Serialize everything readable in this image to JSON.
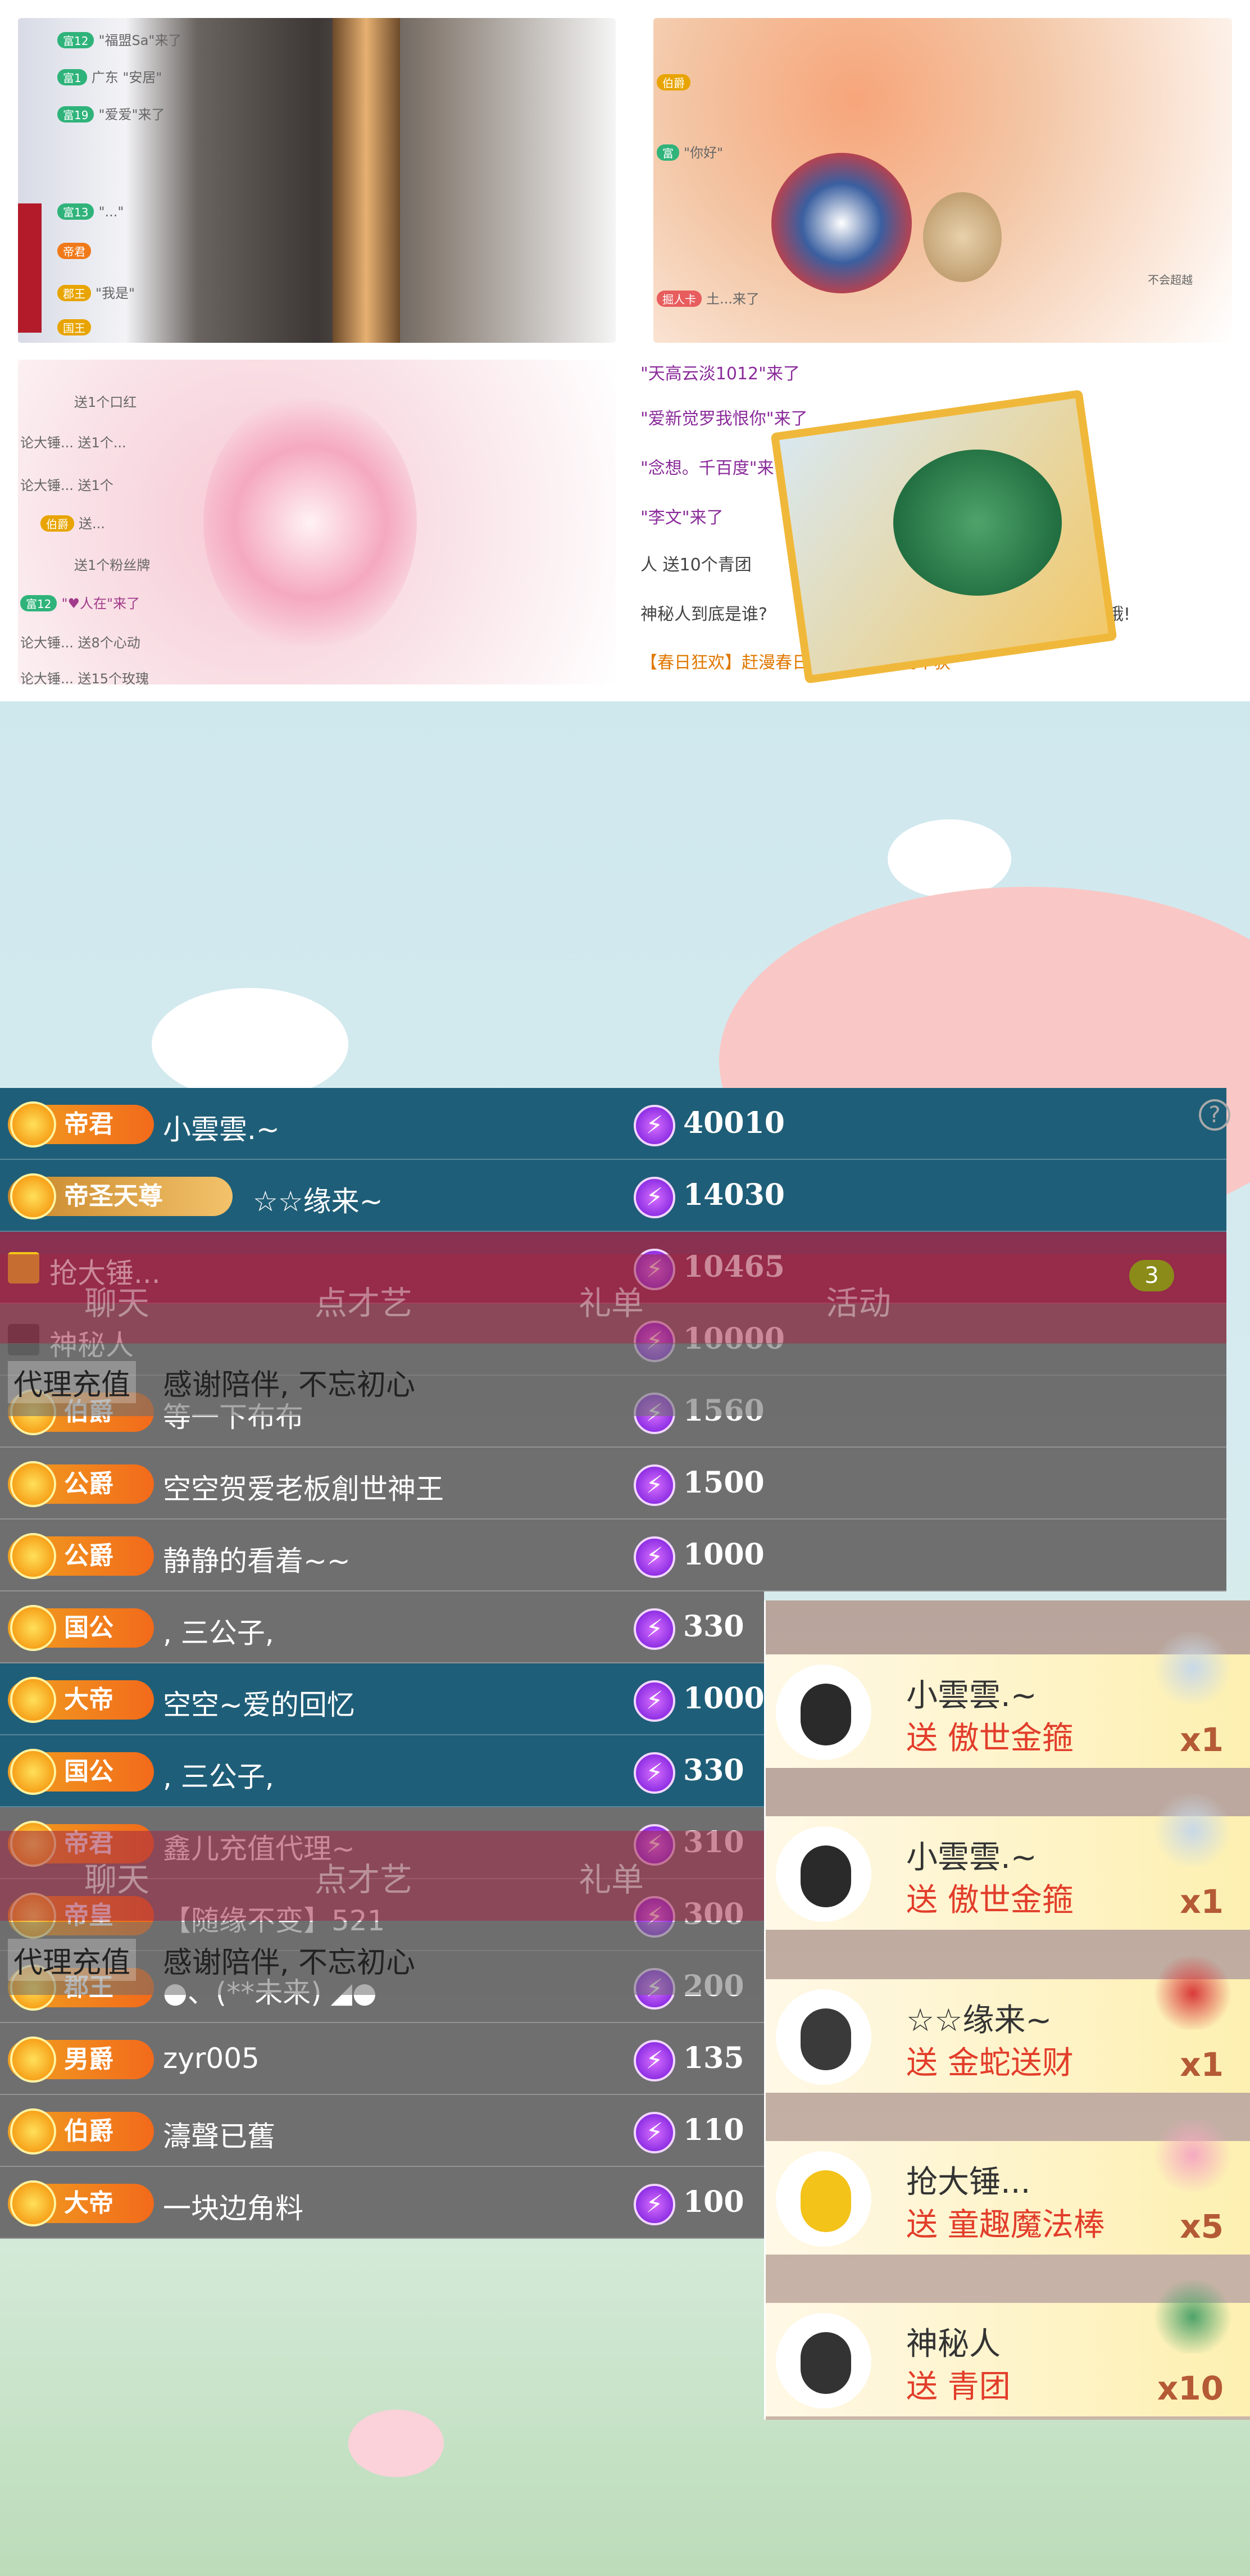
{
  "shots": {
    "s1": {
      "lines": [
        {
          "tag": "富12",
          "text": "\"福盟Sa\"来了"
        },
        {
          "tag": "富1",
          "text": "广东 \"安居\""
        },
        {
          "tag": "富19",
          "text": "\"爱爱\"来了"
        },
        {
          "tag": "富13",
          "text": "\"...\""
        },
        {
          "tag": "帝君",
          "text": ""
        },
        {
          "tag": "郡王",
          "text": "\"我是\""
        },
        {
          "tag": "国王",
          "text": ""
        }
      ]
    },
    "s2": {
      "lines": [
        {
          "tag": "伯爵",
          "text": ""
        },
        {
          "tag": "富",
          "text": "\"你好\""
        },
        {
          "tag": "掘人卡",
          "text": "土...来了"
        }
      ],
      "corner": "不会超越"
    },
    "s3": {
      "lines": [
        {
          "tag": "",
          "text": "送1个口红"
        },
        {
          "tag": "",
          "text": "论大锤... 送1个..."
        },
        {
          "tag": "",
          "text": "论大锤... 送1个"
        },
        {
          "tag": "伯爵",
          "text": "送..."
        },
        {
          "tag": "",
          "text": "送1个粉丝牌"
        },
        {
          "tag": "富12",
          "text": "\"♥人在\"来了"
        },
        {
          "tag": "",
          "text": "论大锤... 送8个心动"
        },
        {
          "tag": "",
          "text": "论大锤... 送15个玫瑰"
        }
      ]
    },
    "s4": {
      "lines": [
        "\"天高云淡1012\"来了",
        "\"爱新觉罗我恨你\"来了",
        "\"念想。千百度\"来了",
        "\"李文\"来了",
        "人 送10个青团",
        "神秘人到底是谁?",
        "【春日狂欢】赶漫春日, 日漫游\" 活动中获"
      ],
      "trailing": "哦!"
    }
  },
  "ranking": [
    {
      "badge": "帝君",
      "name": "小雲雲.~",
      "score": "40010"
    },
    {
      "badge": "帝圣天尊",
      "name": "☆☆缘来~",
      "score": "14030"
    },
    {
      "badge": "",
      "name": "抢大锤...",
      "score": "10465"
    },
    {
      "badge": "",
      "name": "神秘人",
      "score": "10000"
    },
    {
      "badge": "伯爵",
      "name": "等一下布布",
      "score": "1560"
    },
    {
      "badge": "公爵",
      "name": "空空贺爱老板創世神王",
      "score": "1500"
    },
    {
      "badge": "公爵",
      "name": "静静的看着~~",
      "score": "1000"
    },
    {
      "badge": "国公",
      "name": ", 三公子,",
      "score": "330"
    },
    {
      "badge": "大帝",
      "name": "空空~爱的回忆",
      "score": "1000"
    },
    {
      "badge": "国公",
      "name": ", 三公子,",
      "score": "330"
    },
    {
      "badge": "帝君",
      "name": "鑫儿充值代理~",
      "score": "310"
    },
    {
      "badge": "帝皇",
      "name": "【随缘不变】521",
      "score": "300"
    },
    {
      "badge": "郡王",
      "name": "●、(**未来) ◢●",
      "score": "200"
    },
    {
      "badge": "男爵",
      "name": "zyr005",
      "score": "135"
    },
    {
      "badge": "伯爵",
      "name": "濤聲已舊",
      "score": "110"
    },
    {
      "badge": "大帝",
      "name": "一块边角料",
      "score": "100"
    }
  ],
  "tabs": {
    "labels": [
      "聊天",
      "点才艺",
      "礼单",
      "活动"
    ],
    "badge_count": "3"
  },
  "overlay": {
    "agent_label": "代理充值",
    "motto": "感谢陪伴, 不忘初心"
  },
  "help_label": "?",
  "gifts": [
    {
      "name": "小雲雲.~",
      "text": "送 傲世金箍",
      "count": "x1"
    },
    {
      "name": "小雲雲.~",
      "text": "送 傲世金箍",
      "count": "x1"
    },
    {
      "name": "☆☆缘来~",
      "text": "送 金蛇送财",
      "count": "x1"
    },
    {
      "name": "抢大锤...",
      "text": "送 童趣魔法棒",
      "count": "x5"
    },
    {
      "name": "神秘人",
      "text": "送 青团",
      "count": "x10"
    }
  ],
  "colors": {
    "row_blue": "#1f5e78",
    "row_gray": "#6f6f70",
    "accent_purple": "#8a2be2",
    "badge_orange": "#f26a1b",
    "gift_red": "#e23d2a"
  }
}
